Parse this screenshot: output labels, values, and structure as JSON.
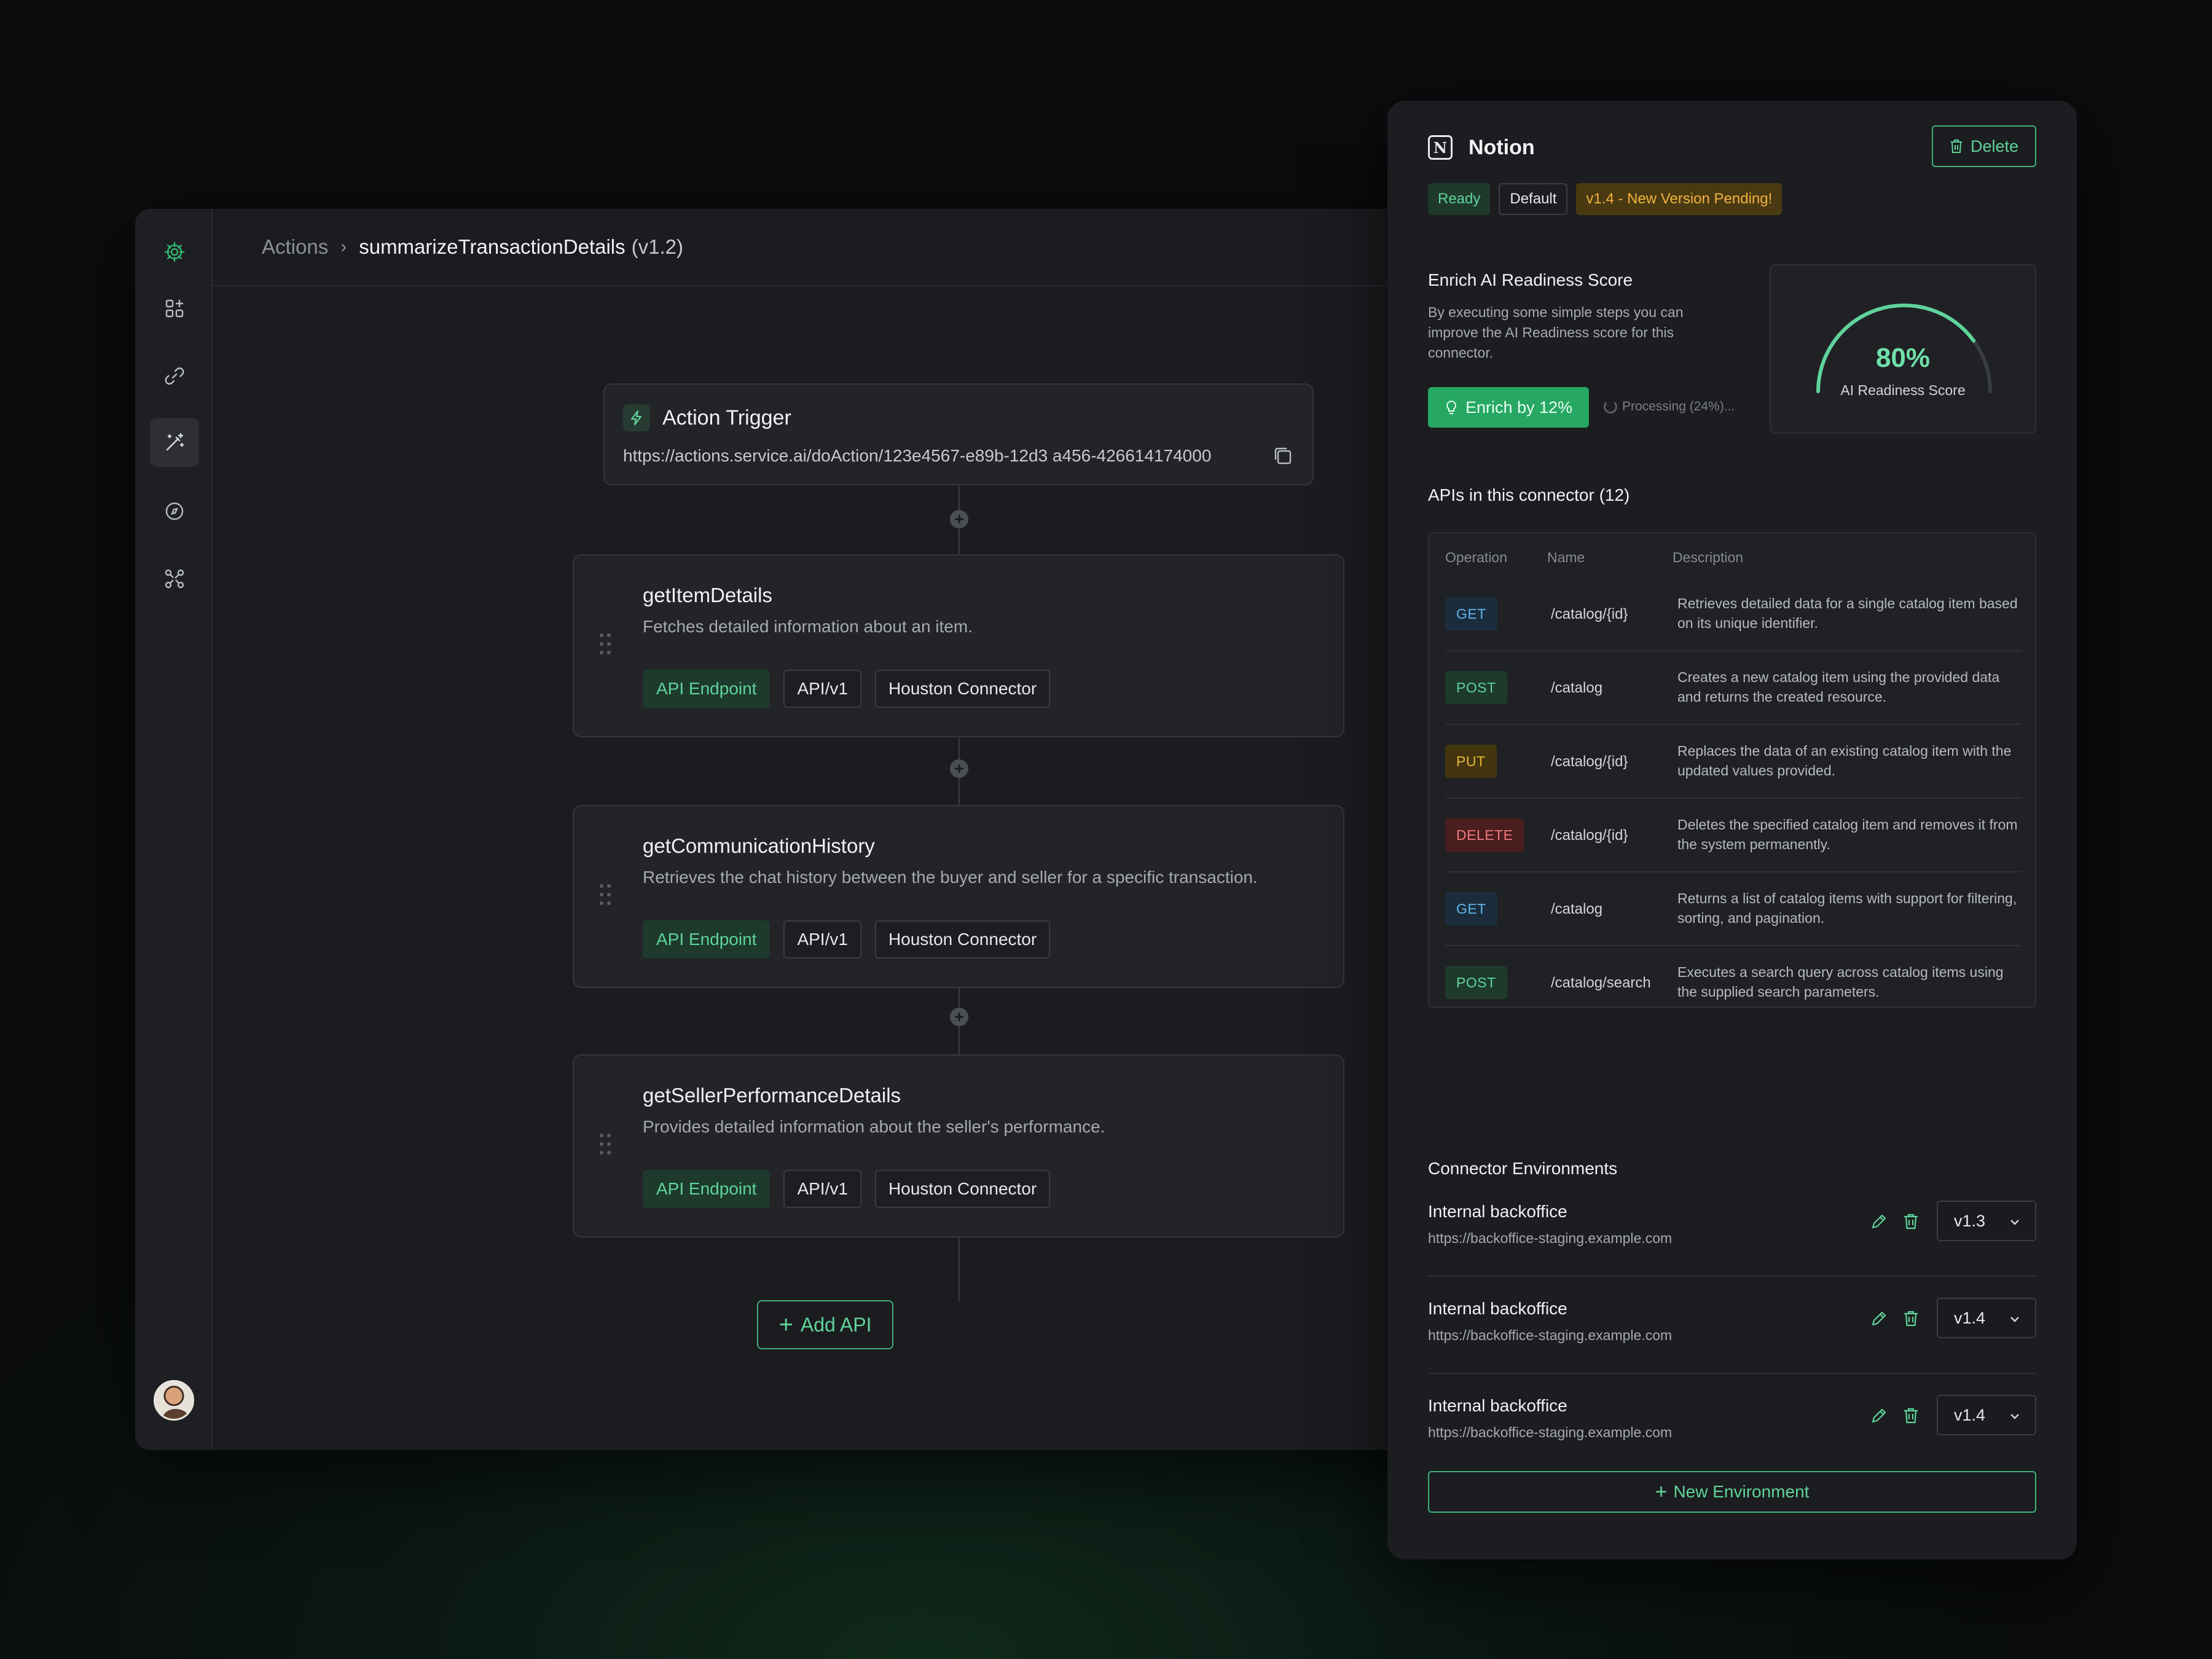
{
  "breadcrumb": {
    "root": "Actions",
    "current": "summarizeTransactionDetails",
    "version": "(v1.2)"
  },
  "sidebar": {
    "items": [
      {
        "icon": "add-widget-icon"
      },
      {
        "icon": "link-icon"
      },
      {
        "icon": "magic-wand-icon",
        "active": true
      },
      {
        "icon": "compass-icon"
      },
      {
        "icon": "graph-nodes-icon"
      }
    ]
  },
  "trigger": {
    "title": "Action Trigger",
    "url": "https://actions.service.ai/doAction/123e4567-e89b-12d3 a456-426614174000"
  },
  "steps": [
    {
      "title": "getItemDetails",
      "description": "Fetches detailed information about an item.",
      "chips": [
        "API Endpoint",
        "API/v1",
        "Houston Connector"
      ]
    },
    {
      "title": "getCommunicationHistory",
      "description": "Retrieves the chat history between the buyer and seller for a specific transaction.",
      "chips": [
        "API Endpoint",
        "API/v1",
        "Houston Connector"
      ]
    },
    {
      "title": "getSellerPerformanceDetails",
      "description": "Provides detailed information about the seller's performance.",
      "chips": [
        "API Endpoint",
        "API/v1",
        "Houston Connector"
      ]
    }
  ],
  "add_api_label": "Add API",
  "panel": {
    "title": "Notion",
    "delete_label": "Delete",
    "badges": {
      "ready": "Ready",
      "default": "Default",
      "pending": "v1.4 - New Version Pending!"
    },
    "enrich": {
      "title": "Enrich AI Readiness Score",
      "description": "By executing some simple steps you can improve the AI Readiness score for this connector.",
      "button_label": "Enrich by 12%",
      "processing_label": "Processing (24%)..."
    },
    "score": {
      "value_label": "80%",
      "value": 0.8,
      "label": "AI Readiness Score"
    },
    "apis_title": "APIs in this connector (12)",
    "table": {
      "headers": [
        "Operation",
        "Name",
        "Description"
      ],
      "rows": [
        {
          "method": "GET",
          "path": "/catalog/{id}",
          "description": "Retrieves detailed data for a single catalog item based on its unique identifier."
        },
        {
          "method": "POST",
          "path": "/catalog",
          "description": "Creates a new catalog item using the provided data and returns the created resource."
        },
        {
          "method": "PUT",
          "path": "/catalog/{id}",
          "description": "Replaces the data of an existing catalog item with the updated values provided."
        },
        {
          "method": "DELETE",
          "path": "/catalog/{id}",
          "description": "Deletes the specified catalog item and removes it from the system permanently."
        },
        {
          "method": "GET",
          "path": "/catalog",
          "description": "Returns a list of catalog items with support for filtering, sorting, and pagination."
        },
        {
          "method": "POST",
          "path": "/catalog/search",
          "description": "Executes a search query across catalog items using the supplied search parameters."
        }
      ]
    },
    "environments_title": "Connector Environments",
    "environments": [
      {
        "name": "Internal backoffice",
        "url": "https://backoffice-staging.example.com",
        "version": "v1.3"
      },
      {
        "name": "Internal backoffice",
        "url": "https://backoffice-staging.example.com",
        "version": "v1.4"
      },
      {
        "name": "Internal backoffice",
        "url": "https://backoffice-staging.example.com",
        "version": "v1.4"
      }
    ],
    "new_environment_label": "New Environment"
  },
  "colors": {
    "accent": "#3fb07a",
    "accent_text": "#5fd39a",
    "background": "#1b1c1f",
    "pending": "#f0b33d"
  }
}
